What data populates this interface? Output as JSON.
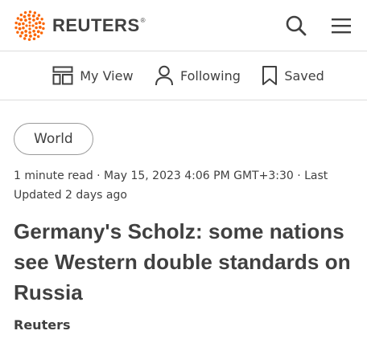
{
  "header": {
    "brand_name": "REUTERS",
    "brand_mark": "®",
    "logo_icon": "reuters-dot-logo",
    "search_icon": "search-icon",
    "menu_icon": "hamburger-menu-icon",
    "brand_color": "#fa6400"
  },
  "subnav": {
    "items": [
      {
        "label": "My View",
        "icon": "layout-icon"
      },
      {
        "label": "Following",
        "icon": "person-icon"
      },
      {
        "label": "Saved",
        "icon": "bookmark-icon"
      }
    ]
  },
  "article": {
    "section": "World",
    "meta": "1 minute read · May 15, 2023 4:06 PM GMT+3:30 · Last Updated 2 days ago",
    "headline": "Germany's Scholz: some nations see Western double standards on Russia",
    "byline": "Reuters"
  }
}
